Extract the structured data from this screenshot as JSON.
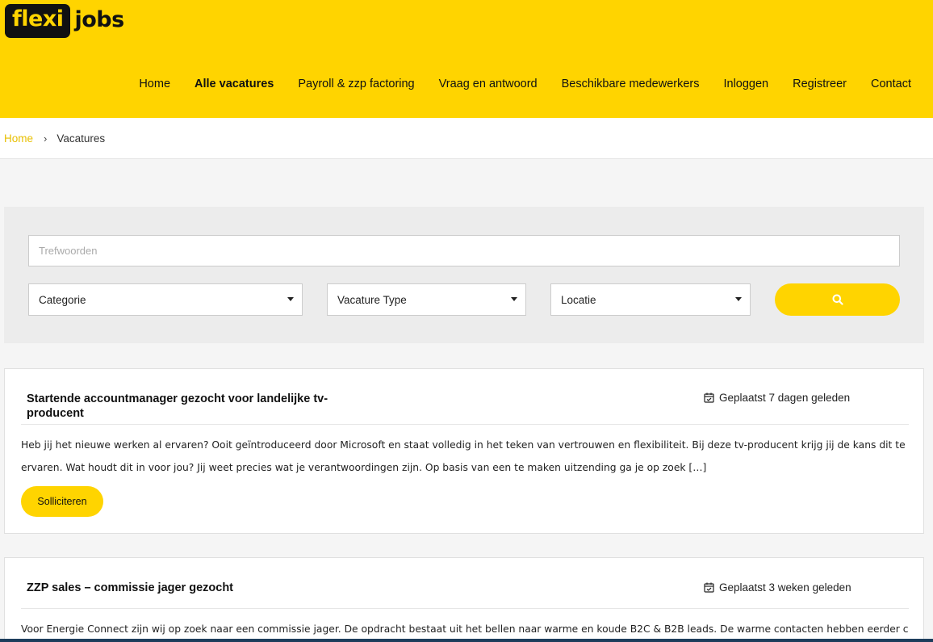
{
  "logo": {
    "part1": "flexi",
    "part2": "jobs"
  },
  "nav": {
    "items": [
      {
        "label": "Home"
      },
      {
        "label": "Alle vacatures"
      },
      {
        "label": "Payroll & zzp factoring"
      },
      {
        "label": "Vraag en antwoord"
      },
      {
        "label": "Beschikbare medewerkers"
      },
      {
        "label": "Inloggen"
      },
      {
        "label": "Registreer"
      },
      {
        "label": "Contact"
      }
    ],
    "active_index": 1
  },
  "breadcrumb": {
    "home": "Home",
    "separator": "›",
    "current": "Vacatures"
  },
  "search": {
    "keywords_placeholder": "Trefwoorden",
    "category": "Categorie",
    "job_type": "Vacature Type",
    "location": "Locatie",
    "button_icon": "search-icon"
  },
  "jobs": [
    {
      "title": "Startende accountmanager gezocht voor landelijke tv-producent",
      "posted": "Geplaatst 7 dagen geleden",
      "description": "Heb jij het nieuwe werken al ervaren? Ooit geïntroduceerd door Microsoft en staat volledig in het teken van vertrouwen en flexibiliteit. Bij deze tv-producent krijg jij de kans dit te ervaren. Wat houdt dit in voor jou? Jij weet precies wat je verantwoordingen zijn. Op basis van een te maken uitzending ga je op zoek […]",
      "apply_label": "Solliciteren"
    },
    {
      "title": "ZZP sales – commissie jager gezocht",
      "posted": "Geplaatst 3 weken geleden",
      "description": "Voor Energie Connect zijn wij op zoek naar een commissie jager. De opdracht bestaat uit het bellen naar warme en koude B2C & B2B leads. De warme contacten hebben eerder contact"
    }
  ],
  "colors": {
    "brand_yellow": "#ffd400",
    "logo_dark": "#111111",
    "breadcrumb_link": "#e8bf00"
  }
}
